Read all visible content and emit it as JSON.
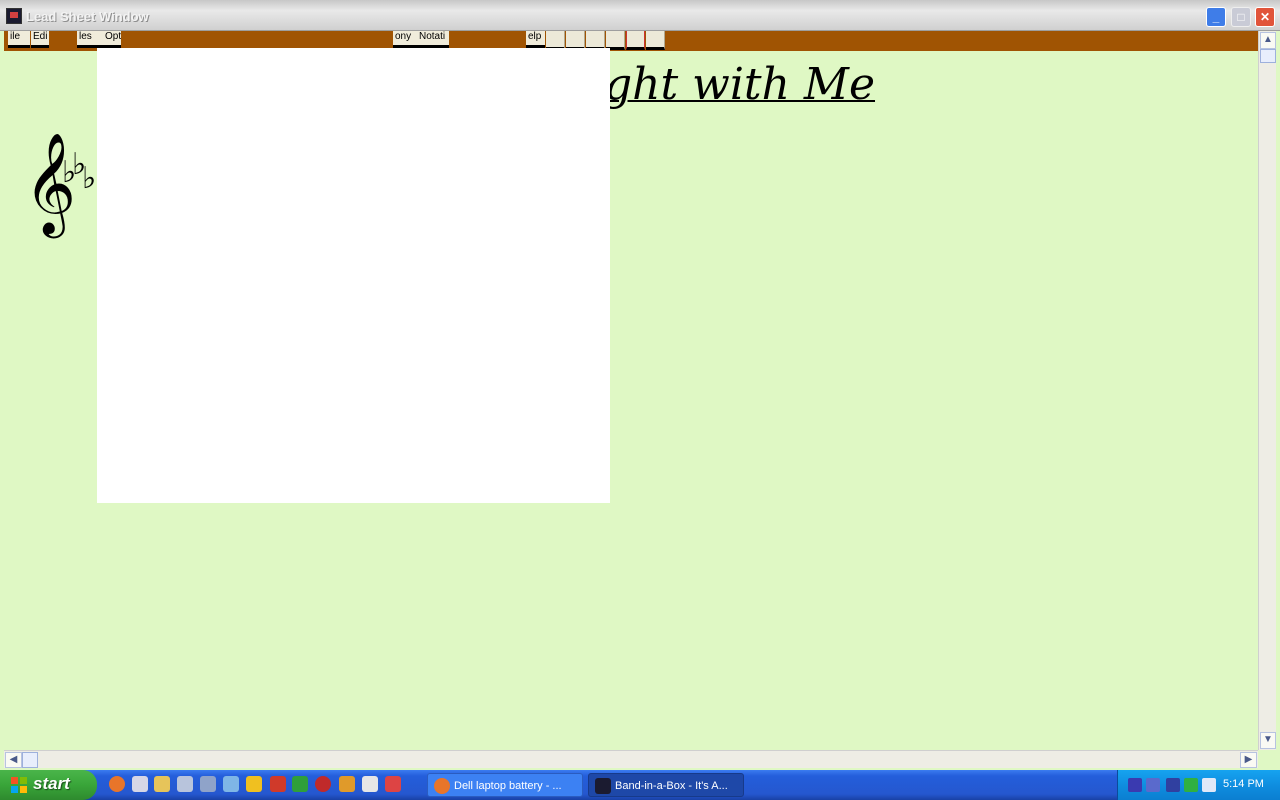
{
  "window": {
    "title": "Lead Sheet Window"
  },
  "menu": {
    "items": [
      "ile",
      "Edi",
      "les",
      "Opt",
      "ony",
      "Notati",
      "elp"
    ]
  },
  "sheet": {
    "title_visible": "ght with Me"
  },
  "taskbar": {
    "start_label": "start",
    "tasks": [
      {
        "label": "Dell laptop battery - ...",
        "icon": "firefox-icon"
      },
      {
        "label": "Band-in-a-Box - It's A...",
        "icon": "band-in-a-box-icon"
      }
    ],
    "clock": "5:14 PM"
  },
  "colors": {
    "menubar": "#a05403",
    "sheet_background": "#dff8c4",
    "taskbar": "#245edb",
    "start_button": "#39a539"
  }
}
